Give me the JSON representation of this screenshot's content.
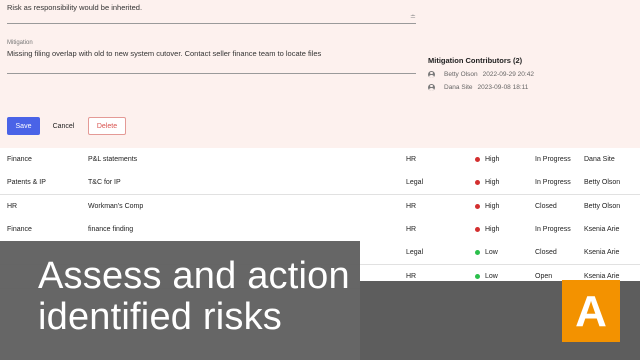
{
  "form": {
    "risk_text": "Risk as responsibility would be inherited.",
    "mitigation_label": "Mitigation",
    "mitigation_text": "Missing filing overlap with old to new system cutover. Contact seller finance team to locate files"
  },
  "contributors": {
    "title": "Mitigation Contributors (2)",
    "items": [
      {
        "name": "Betty Olson",
        "date": "2022-09-29 20:42"
      },
      {
        "name": "Dana Site",
        "date": "2023-09-08 18:11"
      }
    ]
  },
  "actions": {
    "save": "Save",
    "cancel": "Cancel",
    "delete": "Delete"
  },
  "colors": {
    "accent": "#4a63e7",
    "high": "#d32f2f",
    "low": "#2bbf4b",
    "brand": "#f39200"
  },
  "rows": [
    {
      "category": "Finance",
      "item": "P&L statements",
      "dept": "HR",
      "level": "High",
      "status": "In Progress",
      "owner": "Dana Site"
    },
    {
      "category": "Patents & IP",
      "item": "T&C for IP",
      "dept": "Legal",
      "level": "High",
      "status": "In Progress",
      "owner": "Betty Olson"
    },
    {
      "category": "HR",
      "item": "Workman's Comp",
      "dept": "HR",
      "level": "High",
      "status": "Closed",
      "owner": "Betty Olson"
    },
    {
      "category": "Finance",
      "item": "finance finding",
      "dept": "HR",
      "level": "High",
      "status": "In Progress",
      "owner": "Ksenia Arie"
    },
    {
      "category": "",
      "item": "",
      "dept": "Legal",
      "level": "Low",
      "status": "Closed",
      "owner": "Ksenia Arie"
    },
    {
      "category": "",
      "item": "",
      "dept": "HR",
      "level": "Low",
      "status": "Open",
      "owner": "Ksenia Arie"
    }
  ],
  "banner": {
    "line1": "Assess and action",
    "line2": "identified risks"
  },
  "logo": {
    "letter": "A"
  }
}
